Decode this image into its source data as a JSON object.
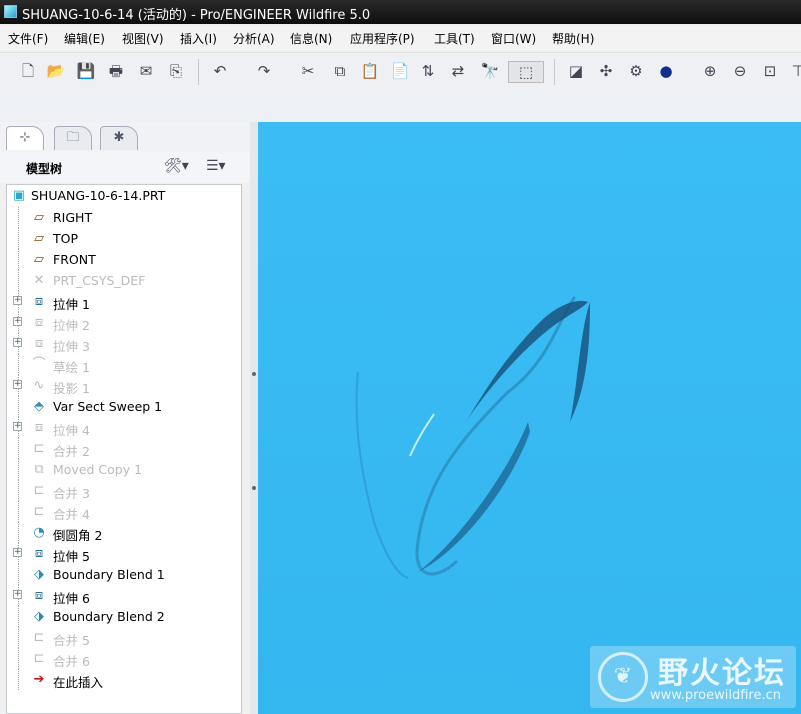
{
  "window": {
    "title": "SHUANG-10-6-14 (活动的) - Pro/ENGINEER Wildfire 5.0"
  },
  "menu": [
    "文件(F)",
    "编辑(E)",
    "视图(V)",
    "插入(I)",
    "分析(A)",
    "信息(N)",
    "应用程序(P)",
    "工具(T)",
    "窗口(W)",
    "帮助(H)"
  ],
  "model_tree": {
    "header": "模型树",
    "root": "SHUANG-10-6-14.PRT",
    "items": [
      {
        "label": "RIGHT",
        "icon": "datum-plane-icon",
        "expand": false,
        "dim": false
      },
      {
        "label": "TOP",
        "icon": "datum-plane-icon",
        "expand": false,
        "dim": false
      },
      {
        "label": "FRONT",
        "icon": "datum-plane-icon",
        "expand": false,
        "dim": false
      },
      {
        "label": "PRT_CSYS_DEF",
        "icon": "csys-icon",
        "expand": false,
        "dim": true
      },
      {
        "label": "拉伸 1",
        "icon": "extrude-icon",
        "expand": true,
        "dim": false
      },
      {
        "label": "拉伸 2",
        "icon": "extrude-icon",
        "expand": true,
        "dim": true
      },
      {
        "label": "拉伸 3",
        "icon": "extrude-icon",
        "expand": true,
        "dim": true
      },
      {
        "label": "草绘 1",
        "icon": "sketch-icon",
        "expand": false,
        "dim": true
      },
      {
        "label": "投影 1",
        "icon": "projection-icon",
        "expand": true,
        "dim": true
      },
      {
        "label": "Var Sect Sweep 1",
        "icon": "sweep-icon",
        "expand": false,
        "dim": false
      },
      {
        "label": "拉伸 4",
        "icon": "extrude-icon",
        "expand": true,
        "dim": true
      },
      {
        "label": "合并 2",
        "icon": "merge-icon",
        "expand": false,
        "dim": true
      },
      {
        "label": "Moved Copy 1",
        "icon": "copy-icon",
        "expand": false,
        "dim": true
      },
      {
        "label": "合并 3",
        "icon": "merge-icon",
        "expand": false,
        "dim": true
      },
      {
        "label": "合并 4",
        "icon": "merge-icon",
        "expand": false,
        "dim": true
      },
      {
        "label": "倒圆角 2",
        "icon": "round-icon",
        "expand": false,
        "dim": false
      },
      {
        "label": "拉伸 5",
        "icon": "extrude-icon",
        "expand": true,
        "dim": false
      },
      {
        "label": "Boundary Blend 1",
        "icon": "boundary-blend-icon",
        "expand": false,
        "dim": false
      },
      {
        "label": "拉伸 6",
        "icon": "extrude-icon",
        "expand": true,
        "dim": false
      },
      {
        "label": "Boundary Blend 2",
        "icon": "boundary-blend-icon",
        "expand": false,
        "dim": false
      },
      {
        "label": "合并 5",
        "icon": "merge-icon",
        "expand": false,
        "dim": true
      },
      {
        "label": "合并 6",
        "icon": "merge-icon",
        "expand": false,
        "dim": true
      },
      {
        "label": "在此插入",
        "icon": "insert-here-icon",
        "expand": false,
        "dim": false
      }
    ]
  },
  "colors": {
    "viewport": "#36b8f1",
    "title_bar": "#141414",
    "insert_arrow": "#c0121a"
  },
  "watermark": {
    "title": "野火论坛",
    "url": "www.proewildfire.cn"
  }
}
